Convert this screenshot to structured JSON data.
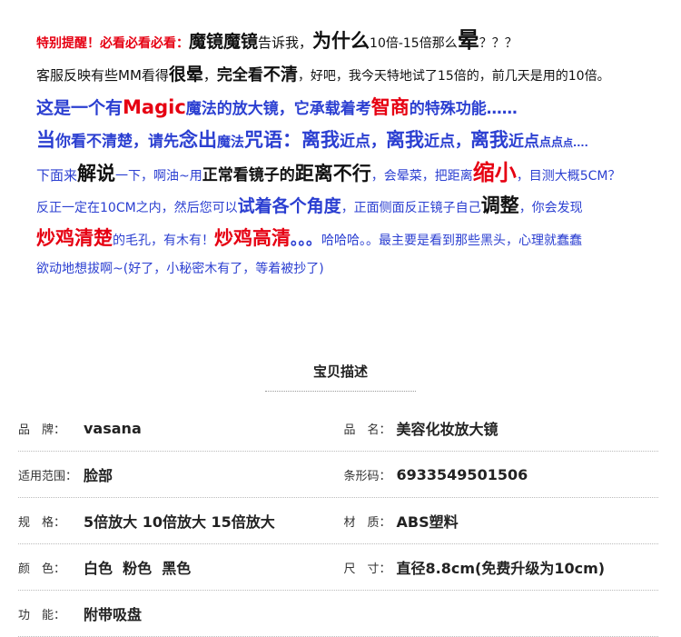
{
  "notes": {
    "line1": {
      "a": "特别提醒！必看必看必看：",
      "b": "魔镜魔镜",
      "c": "告诉我，",
      "d": "为什么",
      "e": "10倍-15倍那么",
      "f": "晕",
      "g": "？？？"
    },
    "line2": {
      "a": "客服反映有些MM看得",
      "b": "很晕",
      "c": "，",
      "d": "完全看",
      "e": "不清",
      "f": "，好吧，我今天特地试了15倍的，前几天是用的10倍。"
    },
    "line3": {
      "a": "这是一个有",
      "b": "Magic",
      "c": "魔法的放大镜，它承载着考",
      "d": "智商",
      "e": "的特殊功能……"
    },
    "line4": {
      "a": "当",
      "b": "你看不清楚，请先",
      "c": "念出",
      "d": "魔法",
      "e": "咒语：离我",
      "f": "近点，",
      "g": "离我",
      "h": "近点，",
      "i": "离我",
      "j": "近点",
      "k": "点点",
      "l": "点...."
    },
    "line5": {
      "a": "下面来",
      "b": "解说",
      "c": "一下，啊油~用",
      "d": "正常看镜子的",
      "e": "距离不行",
      "f": "，会晕菜，把距离",
      "g": "缩小",
      "h": "，目测大概5CM？"
    },
    "line6": {
      "a": "反正一定在10CM之内，然后您可以",
      "b": "试着各个角度",
      "c": "，正面侧面反正镜子自己",
      "d": "调整",
      "e": "，你会发现"
    },
    "line7": {
      "a": "炒鸡清楚",
      "b": "的毛孔，有木有！",
      "c": "炒鸡高清",
      "d": "。。。",
      "e": "哈哈哈。。",
      "f": "最主要是看到那些黑头，心理就蠢蠢"
    },
    "line8": {
      "a": "欲动地想拔啊~(好了，小秘密木有了，等着被抄了)"
    }
  },
  "section_title": "宝贝描述",
  "specs": [
    {
      "left_label": "品　牌：",
      "left_value": "vasana",
      "right_label": "品　名：",
      "right_value": "美容化妆放大镜"
    },
    {
      "left_label": "适用范围：",
      "left_value": "脸部",
      "right_label": "条形码：",
      "right_value": "6933549501506"
    },
    {
      "left_label": "规　格：",
      "left_value": "5倍放大 10倍放大 15倍放大",
      "right_label": "材　质：",
      "right_value": "ABS塑料"
    },
    {
      "left_label": "颜　色：",
      "left_value": "白色  粉色  黑色",
      "right_label": "尺　寸：",
      "right_value": "直径8.8cm(免费升级为10cm)"
    },
    {
      "left_label": "功　能：",
      "left_value": "附带吸盘",
      "right_label": "",
      "right_value": ""
    }
  ],
  "colors": {
    "red": "#e60012",
    "blue": "#2b3fd1",
    "text": "#222222"
  }
}
